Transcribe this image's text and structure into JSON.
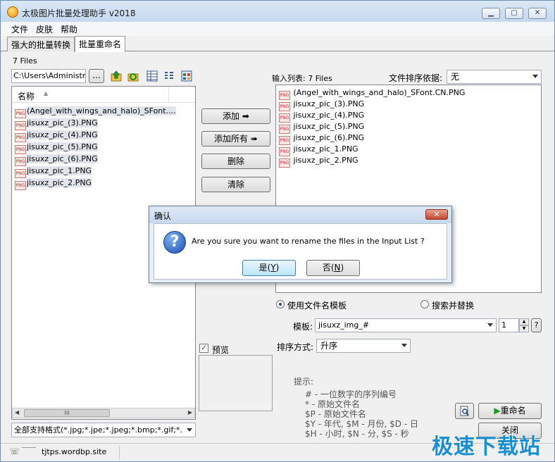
{
  "window": {
    "title": "太极图片批量处理助手  v2018",
    "caption_buttons": [
      "minimize",
      "maximize",
      "close"
    ]
  },
  "menu": [
    "文件",
    "皮肤",
    "帮助"
  ],
  "tabs": [
    {
      "label": "强大的批量转换",
      "active": false
    },
    {
      "label": "批量重命名",
      "active": true
    }
  ],
  "left_panel": {
    "files_count": "7 Files",
    "path_value": "C:\\Users\\Administrat",
    "browse_label": "...",
    "column_header": "名称",
    "files": [
      "(Angel_with_wings_and_halo)_SFont....",
      "jisuxz_pic_(3).PNG",
      "jisuxz_pic_(4).PNG",
      "jisuxz_pic_(5).PNG",
      "jisuxz_pic_(6).PNG",
      "jisuxz_pic_1.PNG",
      "jisuxz_pic_2.PNG"
    ],
    "filter_value": "全部支持格式(*.jpg;*.jpe;*.jpeg;*.bmp;*.gif;*."
  },
  "middle_buttons": {
    "add": "添加",
    "add_all": "添加所有",
    "remove": "删除",
    "clear": "清除",
    "preview_label": "预览"
  },
  "right_panel": {
    "input_list_label": "输入列表: 7 Files",
    "sort_by_label": "文件排序依据:",
    "sort_by_value": "无",
    "files": [
      "(Angel_with_wings_and_halo)_SFont.CN.PNG",
      "jisuxz_pic_(3).PNG",
      "jisuxz_pic_(4).PNG",
      "jisuxz_pic_(5).PNG",
      "jisuxz_pic_(6).PNG",
      "jisuxz_pic_1.PNG",
      "jisuxz_pic_2.PNG"
    ],
    "radio_template": "使用文件名模板",
    "radio_replace": "搜索并替换",
    "template_label": "模板:",
    "template_value": "jisuxz_img_#",
    "start_value": "1",
    "help_label": "?",
    "order_label": "排序方式:",
    "order_value": "升序",
    "hint_title": "提示:",
    "hints": [
      "# - 一位数字的序列编号",
      "*  - 原始文件名",
      "$P - 原始文件名",
      "$Y - 年代,    $M - 月份,    $D - 日",
      "$H - 小时,    $N - 分,    $S - 秒"
    ],
    "rename_button": "重命名",
    "close_button": "关闭"
  },
  "status": {
    "url": "tjtps.wordbp.site"
  },
  "dialog": {
    "title": "确认",
    "message": "Are you sure you want to rename the files in the Input List ?",
    "yes_prefix": "是(",
    "yes_key": "Y",
    "no_prefix": "否(",
    "no_key": "N",
    "suffix": ")"
  },
  "watermark": "极速下载站",
  "colors": {
    "accent": "#1b8ed0",
    "titlebar": "#c5d8ef"
  }
}
